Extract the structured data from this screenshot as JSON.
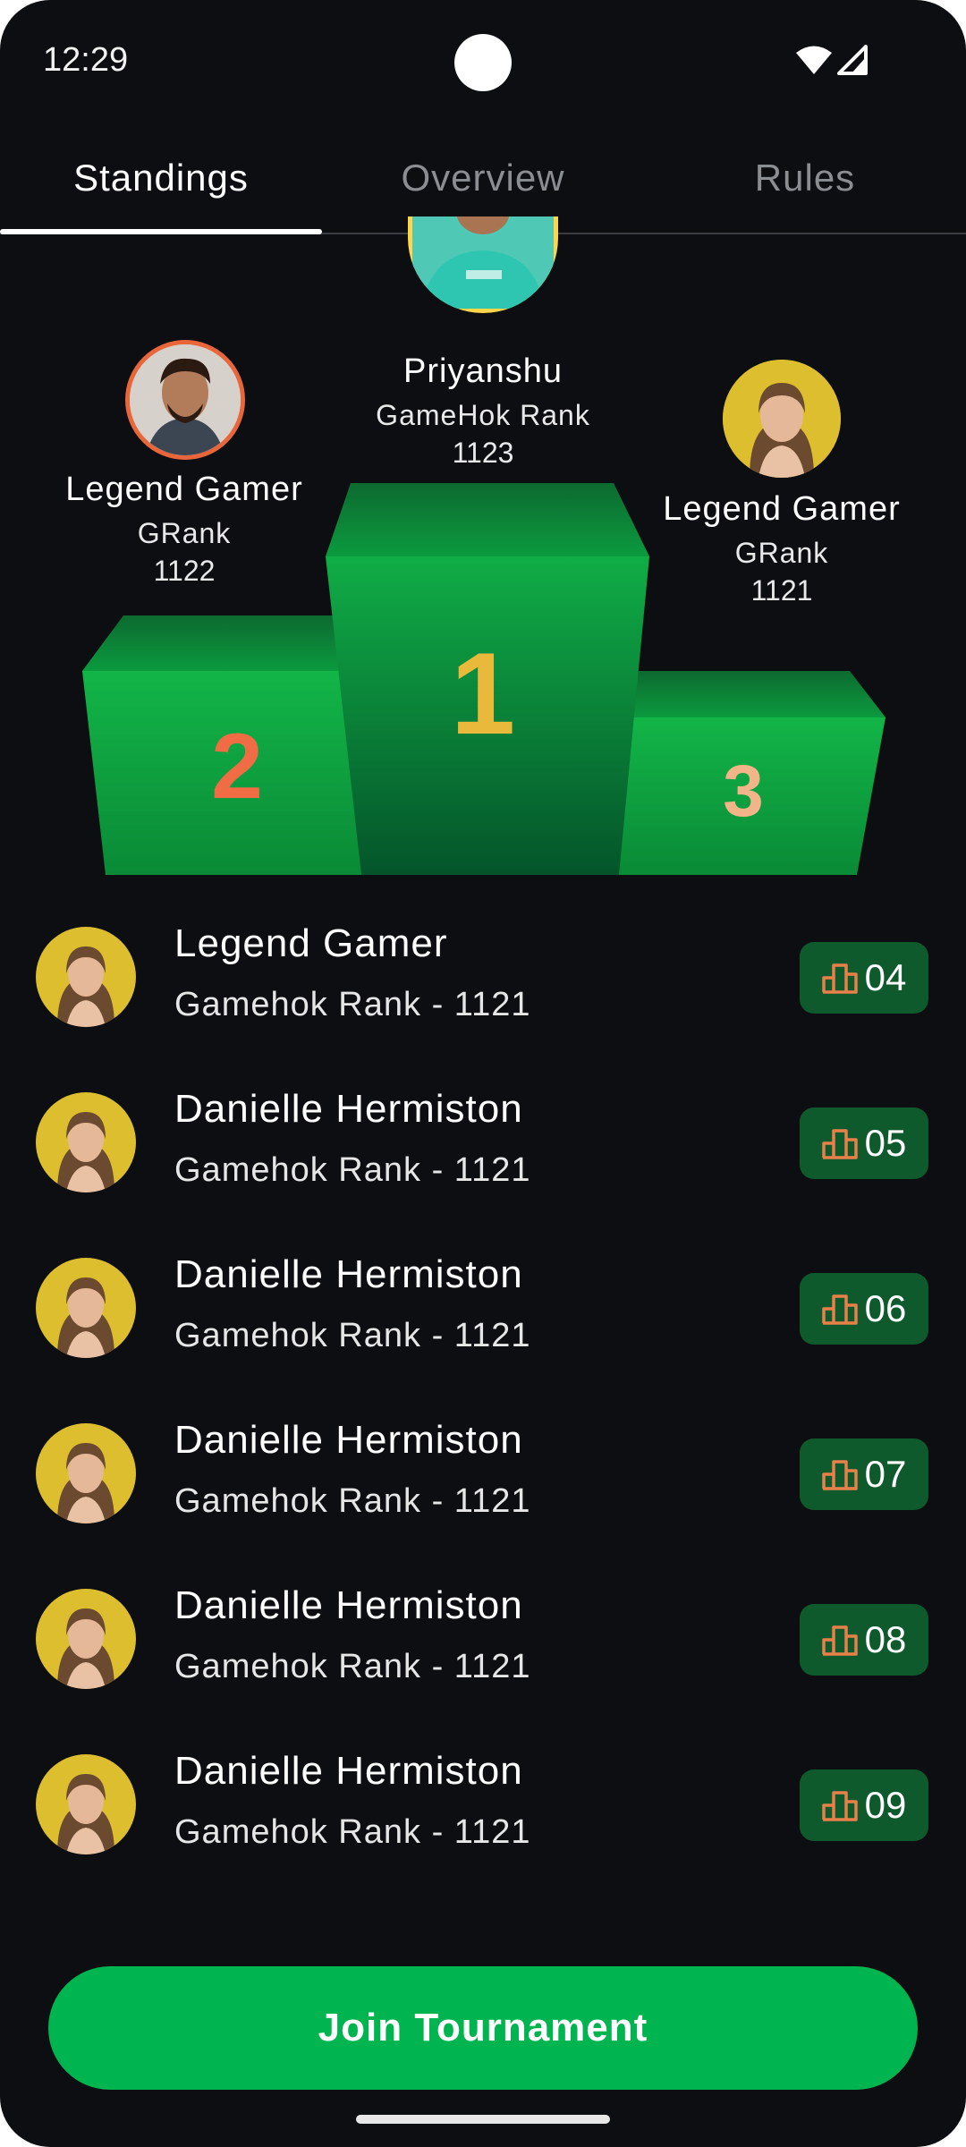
{
  "status_bar": {
    "time": "12:29"
  },
  "tabs": [
    {
      "label": "Standings",
      "active": true
    },
    {
      "label": "Overview",
      "active": false
    },
    {
      "label": "Rules",
      "active": false
    }
  ],
  "podium": {
    "first": {
      "name": "Priyanshu",
      "rank_label": "GameHok Rank",
      "score": "1123",
      "place": "1"
    },
    "second": {
      "name": "Legend Gamer",
      "rank_label": "GRank",
      "score": "1122",
      "place": "2"
    },
    "third": {
      "name": "Legend Gamer",
      "rank_label": "GRank",
      "score": "1121",
      "place": "3"
    }
  },
  "leaderboard": [
    {
      "name": "Legend Gamer",
      "rank_text": "Gamehok Rank - 1121",
      "position": "04"
    },
    {
      "name": "Danielle Hermiston",
      "rank_text": "Gamehok Rank - 1121",
      "position": "05"
    },
    {
      "name": "Danielle Hermiston",
      "rank_text": "Gamehok Rank - 1121",
      "position": "06"
    },
    {
      "name": "Danielle Hermiston",
      "rank_text": "Gamehok Rank - 1121",
      "position": "07"
    },
    {
      "name": "Danielle Hermiston",
      "rank_text": "Gamehok Rank - 1121",
      "position": "08"
    },
    {
      "name": "Danielle Hermiston",
      "rank_text": "Gamehok Rank - 1121",
      "position": "09"
    }
  ],
  "join_button": {
    "label": "Join Tournament"
  },
  "colors": {
    "background": "#0c0e12",
    "accent_green": "#00b450",
    "badge_green": "#0f5a2c",
    "podium_gold": "#e8b93a",
    "podium_orange": "#f06c45",
    "podium_peach": "#f2b58a",
    "badge_icon_orange": "#e8804a"
  },
  "icons": {
    "rank_badge": "leaderboard-bars-icon",
    "wifi": "wifi-icon",
    "signal": "cellular-signal-icon"
  }
}
